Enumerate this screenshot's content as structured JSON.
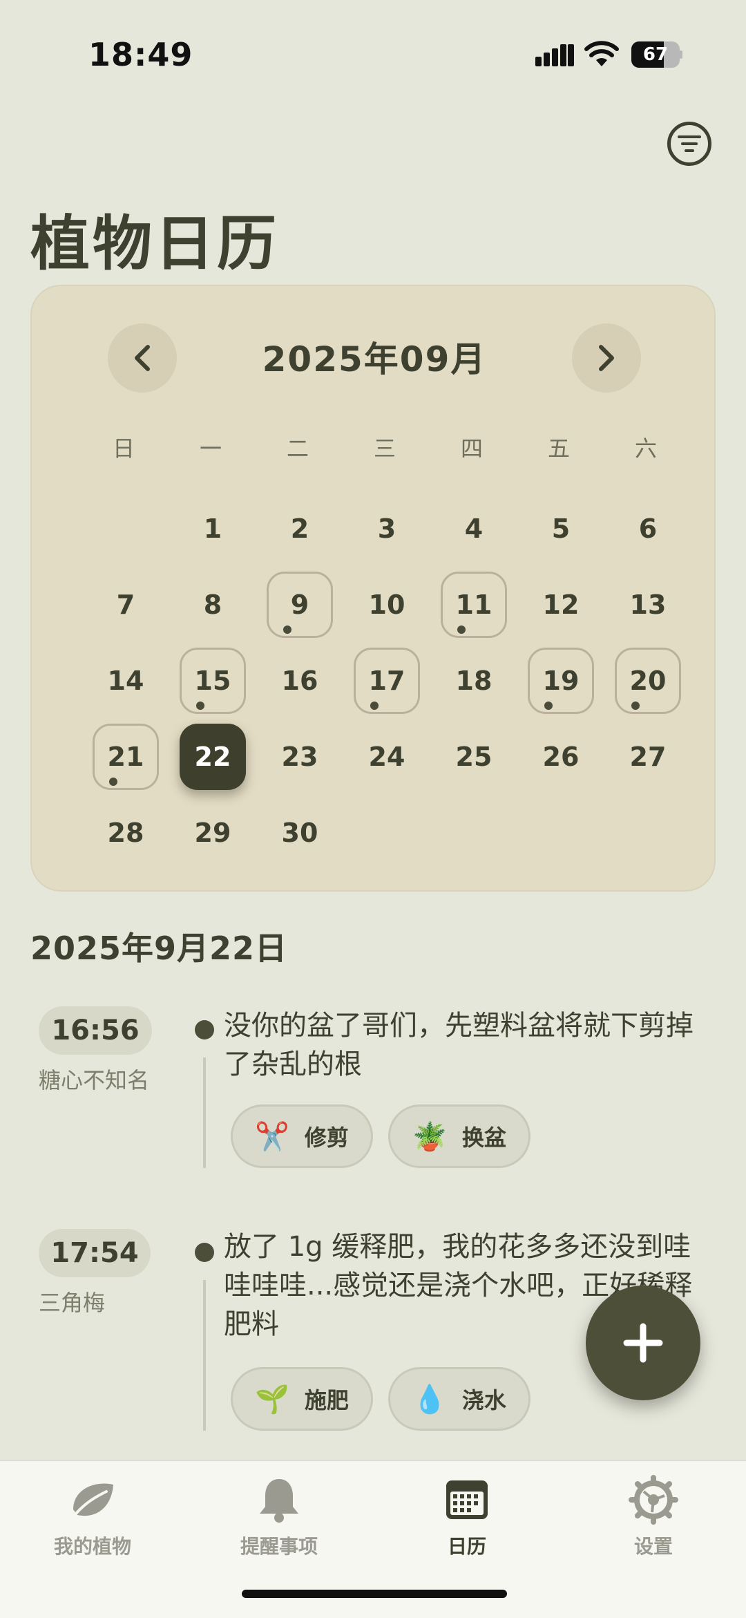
{
  "status": {
    "time": "18:49",
    "battery": "67",
    "battery_level": 0.67
  },
  "header": {
    "title": "植物日历"
  },
  "calendar": {
    "month_label": "2025年09月",
    "weekdays": [
      "日",
      "一",
      "二",
      "三",
      "四",
      "五",
      "六"
    ],
    "start_offset": 1,
    "days": [
      "1",
      "2",
      "3",
      "4",
      "5",
      "6",
      "7",
      "8",
      "9",
      "10",
      "11",
      "12",
      "13",
      "14",
      "15",
      "16",
      "17",
      "18",
      "19",
      "20",
      "21",
      "22",
      "23",
      "24",
      "25",
      "26",
      "27",
      "28",
      "29",
      "30"
    ],
    "event_days": [
      9,
      11,
      15,
      17,
      19,
      20,
      21
    ],
    "today": 22
  },
  "selected_date": "2025年9月22日",
  "entries": [
    {
      "time": "16:56",
      "plant": "糖心不知名",
      "text": "没你的盆了哥们，先塑料盆将就下剪掉了杂乱的根",
      "tags": [
        {
          "icon": "✂️",
          "label": "修剪"
        },
        {
          "icon": "🪴",
          "label": "换盆"
        }
      ]
    },
    {
      "time": "17:54",
      "plant": "三角梅",
      "text": "放了 1g 缓释肥，我的花多多还没到哇哇哇哇...感觉还是浇个水吧，正好稀释肥料",
      "tags": [
        {
          "icon": "🌱",
          "label": "施肥"
        },
        {
          "icon": "💧",
          "label": "浇水"
        }
      ]
    }
  ],
  "nav": {
    "items": [
      {
        "label": "我的植物",
        "icon": "leaf-icon"
      },
      {
        "label": "提醒事项",
        "icon": "bell-icon"
      },
      {
        "label": "日历",
        "icon": "calendar-icon"
      },
      {
        "label": "设置",
        "icon": "gear-icon"
      }
    ],
    "active": 2
  }
}
